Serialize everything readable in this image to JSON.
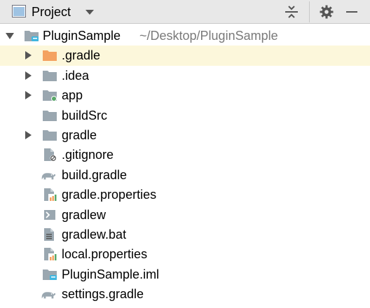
{
  "toolbar": {
    "title": "Project",
    "icons": [
      "project-view-icon",
      "caret-down-icon",
      "collapse-all-icon",
      "gear-icon",
      "hide-icon"
    ]
  },
  "tree": {
    "root": {
      "name": "PluginSample",
      "path": "~/Desktop/PluginSample",
      "expanded": true,
      "icon": "module-folder-icon"
    },
    "items": [
      {
        "name": ".gradle",
        "type": "folder",
        "icon": "folder-orange-icon",
        "expandable": true,
        "selected": true
      },
      {
        "name": ".idea",
        "type": "folder",
        "icon": "folder-icon",
        "expandable": true
      },
      {
        "name": "app",
        "type": "folder",
        "icon": "module-folder-icon",
        "expandable": true
      },
      {
        "name": "buildSrc",
        "type": "folder",
        "icon": "folder-icon",
        "expandable": false
      },
      {
        "name": "gradle",
        "type": "folder",
        "icon": "folder-icon",
        "expandable": true
      },
      {
        "name": ".gitignore",
        "type": "file",
        "icon": "gitignore-file-icon"
      },
      {
        "name": "build.gradle",
        "type": "file",
        "icon": "gradle-elephant-icon"
      },
      {
        "name": "gradle.properties",
        "type": "file",
        "icon": "properties-file-icon"
      },
      {
        "name": "gradlew",
        "type": "file",
        "icon": "shell-script-icon"
      },
      {
        "name": "gradlew.bat",
        "type": "file",
        "icon": "text-file-icon"
      },
      {
        "name": "local.properties",
        "type": "file",
        "icon": "properties-file-icon"
      },
      {
        "name": "PluginSample.iml",
        "type": "file",
        "icon": "iml-module-icon"
      },
      {
        "name": "settings.gradle",
        "type": "file",
        "icon": "gradle-elephant-icon"
      }
    ]
  },
  "colors": {
    "toolbar_bg": "#e8e8e8",
    "selection_bg": "#fcf7db",
    "folder": "#9aa7b0",
    "folder_excluded": "#f4a261",
    "module_badge": "#40b6e0",
    "module_dot": "#59a869",
    "path_text": "#7a7a7a"
  }
}
